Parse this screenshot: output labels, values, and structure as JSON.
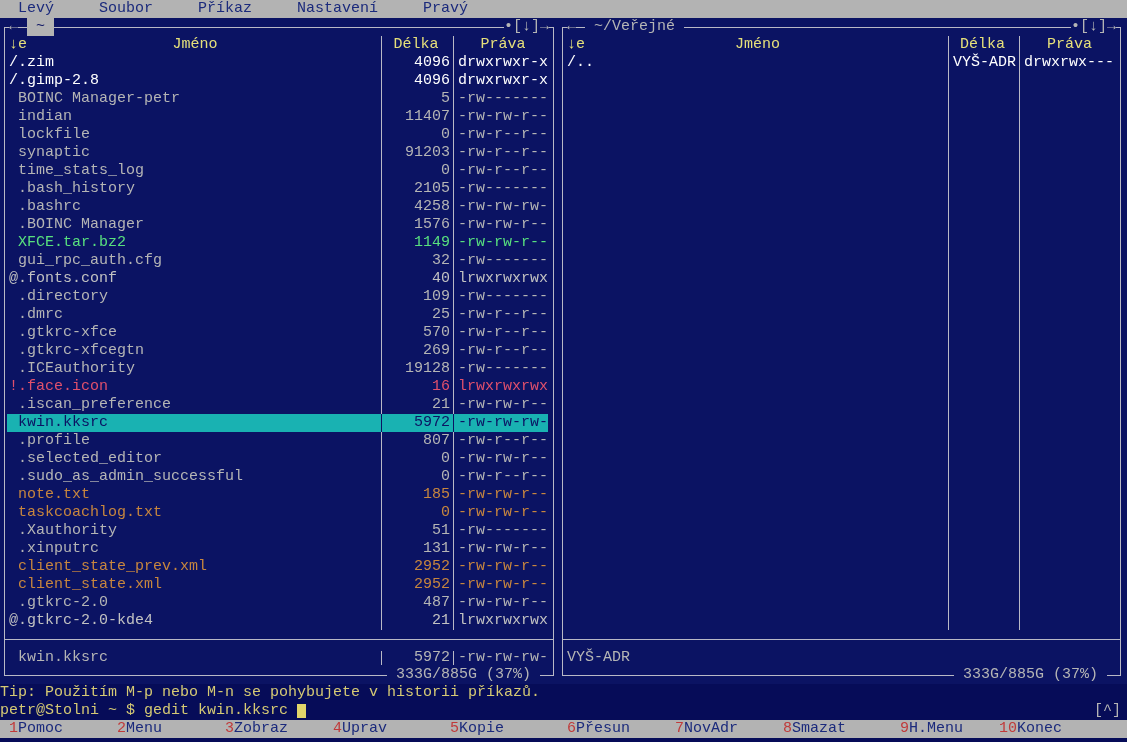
{
  "menu_bar": [
    "Levý",
    "Soubor",
    "Příkaz",
    "Nastavení",
    "Pravý"
  ],
  "panels": [
    {
      "title": "~",
      "active": true,
      "history_back": "←",
      "hotlist": "•",
      "history_list": "[↓]",
      "history_forward": "→",
      "sort_indicator": "↓e",
      "columns": [
        "Jméno",
        "Délka",
        "Práva"
      ],
      "files": [
        {
          "name": "/.zim",
          "size": "4096",
          "permissions": "drwxrwxr-x",
          "kind": "dir",
          "selected": false
        },
        {
          "name": "/.gimp-2.8",
          "size": "4096",
          "permissions": "drwxrwxr-x",
          "kind": "dir",
          "selected": false
        },
        {
          "name": "BOINC Manager-petr",
          "size": "5",
          "permissions": "-rw-------",
          "kind": "file",
          "selected": false
        },
        {
          "name": "indian",
          "size": "11407",
          "permissions": "-rw-rw-r--",
          "kind": "file",
          "selected": false
        },
        {
          "name": "lockfile",
          "size": "0",
          "permissions": "-rw-r--r--",
          "kind": "file",
          "selected": false
        },
        {
          "name": "synaptic",
          "size": "91203",
          "permissions": "-rw-r--r--",
          "kind": "file",
          "selected": false
        },
        {
          "name": "time_stats_log",
          "size": "0",
          "permissions": "-rw-r--r--",
          "kind": "file",
          "selected": false
        },
        {
          "name": ".bash_history",
          "size": "2105",
          "permissions": "-rw-------",
          "kind": "file",
          "selected": false
        },
        {
          "name": ".bashrc",
          "size": "4258",
          "permissions": "-rw-rw-rw-",
          "kind": "file",
          "selected": false
        },
        {
          "name": ".BOINC Manager",
          "size": "1576",
          "permissions": "-rw-rw-r--",
          "kind": "file",
          "selected": false
        },
        {
          "name": "XFCE.tar.bz2",
          "size": "1149",
          "permissions": "-rw-rw-r--",
          "kind": "archive",
          "selected": false
        },
        {
          "name": "gui_rpc_auth.cfg",
          "size": "32",
          "permissions": "-rw-------",
          "kind": "file",
          "selected": false
        },
        {
          "name": "@.fonts.conf",
          "size": "40",
          "permissions": "lrwxrwxrwx",
          "kind": "symlink",
          "selected": false
        },
        {
          "name": ".directory",
          "size": "109",
          "permissions": "-rw-------",
          "kind": "file",
          "selected": false
        },
        {
          "name": ".dmrc",
          "size": "25",
          "permissions": "-rw-r--r--",
          "kind": "file",
          "selected": false
        },
        {
          "name": ".gtkrc-xfce",
          "size": "570",
          "permissions": "-rw-r--r--",
          "kind": "file",
          "selected": false
        },
        {
          "name": ".gtkrc-xfcegtn",
          "size": "269",
          "permissions": "-rw-r--r--",
          "kind": "file",
          "selected": false
        },
        {
          "name": ".ICEauthority",
          "size": "19128",
          "permissions": "-rw-------",
          "kind": "file",
          "selected": false
        },
        {
          "name": "!.face.icon",
          "size": "16",
          "permissions": "lrwxrwxrwx",
          "kind": "broken_link",
          "selected": false
        },
        {
          "name": ".iscan_preference",
          "size": "21",
          "permissions": "-rw-rw-r--",
          "kind": "file",
          "selected": false
        },
        {
          "name": "kwin.kksrc",
          "size": "5972",
          "permissions": "-rw-rw-rw-",
          "kind": "file",
          "selected": true
        },
        {
          "name": ".profile",
          "size": "807",
          "permissions": "-rw-r--r--",
          "kind": "file",
          "selected": false
        },
        {
          "name": ".selected_editor",
          "size": "0",
          "permissions": "-rw-rw-r--",
          "kind": "file",
          "selected": false
        },
        {
          "name": ".sudo_as_admin_successful",
          "size": "0",
          "permissions": "-rw-r--r--",
          "kind": "file",
          "selected": false
        },
        {
          "name": "note.txt",
          "size": "185",
          "permissions": "-rw-rw-r--",
          "kind": "document",
          "selected": false
        },
        {
          "name": "taskcoachlog.txt",
          "size": "0",
          "permissions": "-rw-rw-r--",
          "kind": "document",
          "selected": false
        },
        {
          "name": ".Xauthority",
          "size": "51",
          "permissions": "-rw-------",
          "kind": "file",
          "selected": false
        },
        {
          "name": ".xinputrc",
          "size": "131",
          "permissions": "-rw-rw-r--",
          "kind": "file",
          "selected": false
        },
        {
          "name": "client_state_prev.xml",
          "size": "2952",
          "permissions": "-rw-rw-r--",
          "kind": "document",
          "selected": false
        },
        {
          "name": "client_state.xml",
          "size": "2952",
          "permissions": "-rw-rw-r--",
          "kind": "document",
          "selected": false
        },
        {
          "name": ".gtkrc-2.0",
          "size": "487",
          "permissions": "-rw-rw-r--",
          "kind": "file",
          "selected": false
        },
        {
          "name": "@.gtkrc-2.0-kde4",
          "size": "21",
          "permissions": "lrwxrwxrwx",
          "kind": "symlink",
          "selected": false
        }
      ],
      "mini_status": {
        "name": "kwin.kksrc",
        "size": "5972",
        "permissions": "-rw-rw-rw-",
        "kind": "file"
      },
      "disk_usage": "333G/885G (37%)"
    },
    {
      "title": "~/Veřejné",
      "active": false,
      "history_back": "←",
      "hotlist": "•",
      "history_list": "[↓]",
      "history_forward": "→",
      "sort_indicator": "↓e",
      "columns": [
        "Jméno",
        "Délka",
        "Práva"
      ],
      "files": [
        {
          "name": "/..",
          "size": "VYŠ-ADR",
          "permissions": "drwxrwx---",
          "kind": "dir",
          "selected": false
        }
      ],
      "mini_status": {
        "name": "VYŠ-ADR",
        "kind": "dir"
      },
      "disk_usage": "333G/885G (37%)"
    }
  ],
  "tip": "Tip: Použitím M-p nebo M-n se pohybujete v historii příkazů.",
  "command_line": {
    "prompt": "petr@Stolni ~ $",
    "value": "gedit kwin.kksrc",
    "history_button": "[^]"
  },
  "function_keys": [
    {
      "key": "1",
      "label": "Pomoc"
    },
    {
      "key": "2",
      "label": "Menu"
    },
    {
      "key": "3",
      "label": "Zobraz"
    },
    {
      "key": "4",
      "label": "Uprav"
    },
    {
      "key": "5",
      "label": "Kopie"
    },
    {
      "key": "6",
      "label": "Přesun"
    },
    {
      "key": "7",
      "label": "NovAdr"
    },
    {
      "key": "8",
      "label": "Smazat"
    },
    {
      "key": "9",
      "label": "H.Menu"
    },
    {
      "key": "10",
      "label": "Konec"
    }
  ]
}
